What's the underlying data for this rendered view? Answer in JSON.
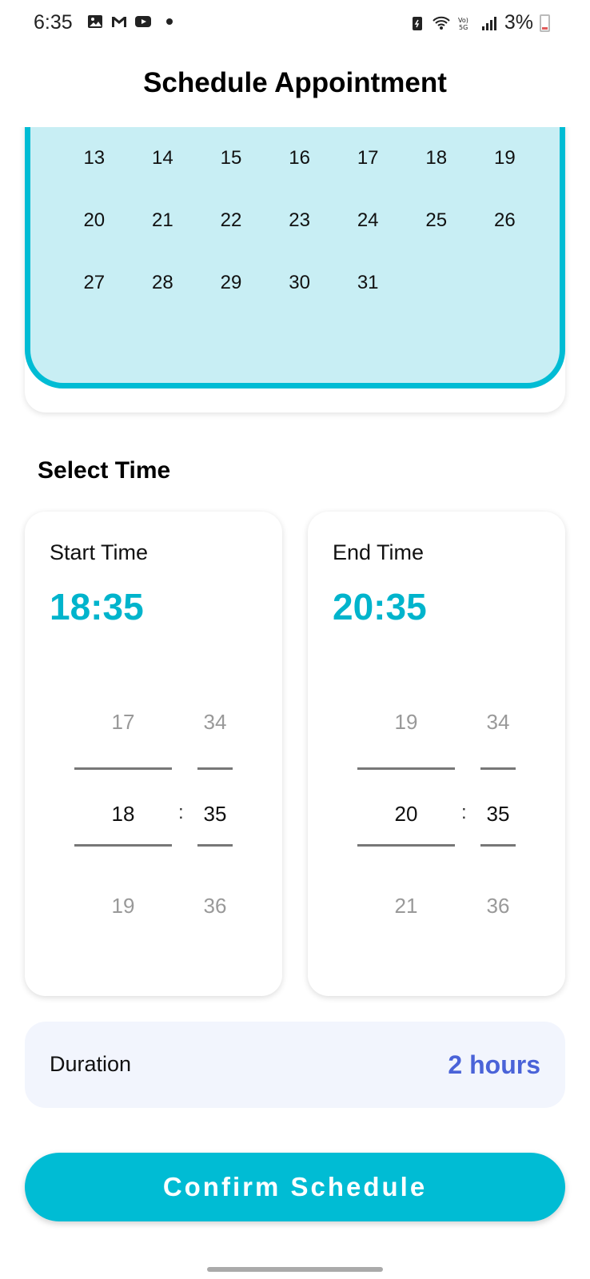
{
  "status_bar": {
    "time": "6:35",
    "battery": "3%",
    "left_icons": [
      "gallery-icon",
      "gmail-icon",
      "youtube-icon",
      "dot"
    ],
    "right_icons": [
      "battery-saver-icon",
      "wifi-icon",
      "volte-5g-icon",
      "signal-icon"
    ]
  },
  "header": {
    "title": "Schedule Appointment"
  },
  "calendar": {
    "weeks": [
      [
        "13",
        "14",
        "15",
        "16",
        "17",
        "18",
        "19"
      ],
      [
        "20",
        "21",
        "22",
        "23",
        "24",
        "25",
        "26"
      ],
      [
        "27",
        "28",
        "29",
        "30",
        "31",
        "",
        ""
      ]
    ]
  },
  "select_time": {
    "title": "Select Time",
    "start": {
      "label": "Start Time",
      "value": "18:35",
      "hour_prev": "17",
      "hour_current": "18",
      "hour_next": "19",
      "min_prev": "34",
      "min_current": "35",
      "min_next": "36"
    },
    "end": {
      "label": "End Time",
      "value": "20:35",
      "hour_prev": "19",
      "hour_current": "20",
      "hour_next": "21",
      "min_prev": "34",
      "min_current": "35",
      "min_next": "36"
    },
    "separator": ":"
  },
  "duration": {
    "label": "Duration",
    "value": "2 hours"
  },
  "confirm_label": "Confirm Schedule",
  "colors": {
    "accent": "#00bcd4",
    "calendar_bg": "#c8eef4",
    "duration_value": "#4a63d8",
    "time_value": "#00b4cc"
  }
}
